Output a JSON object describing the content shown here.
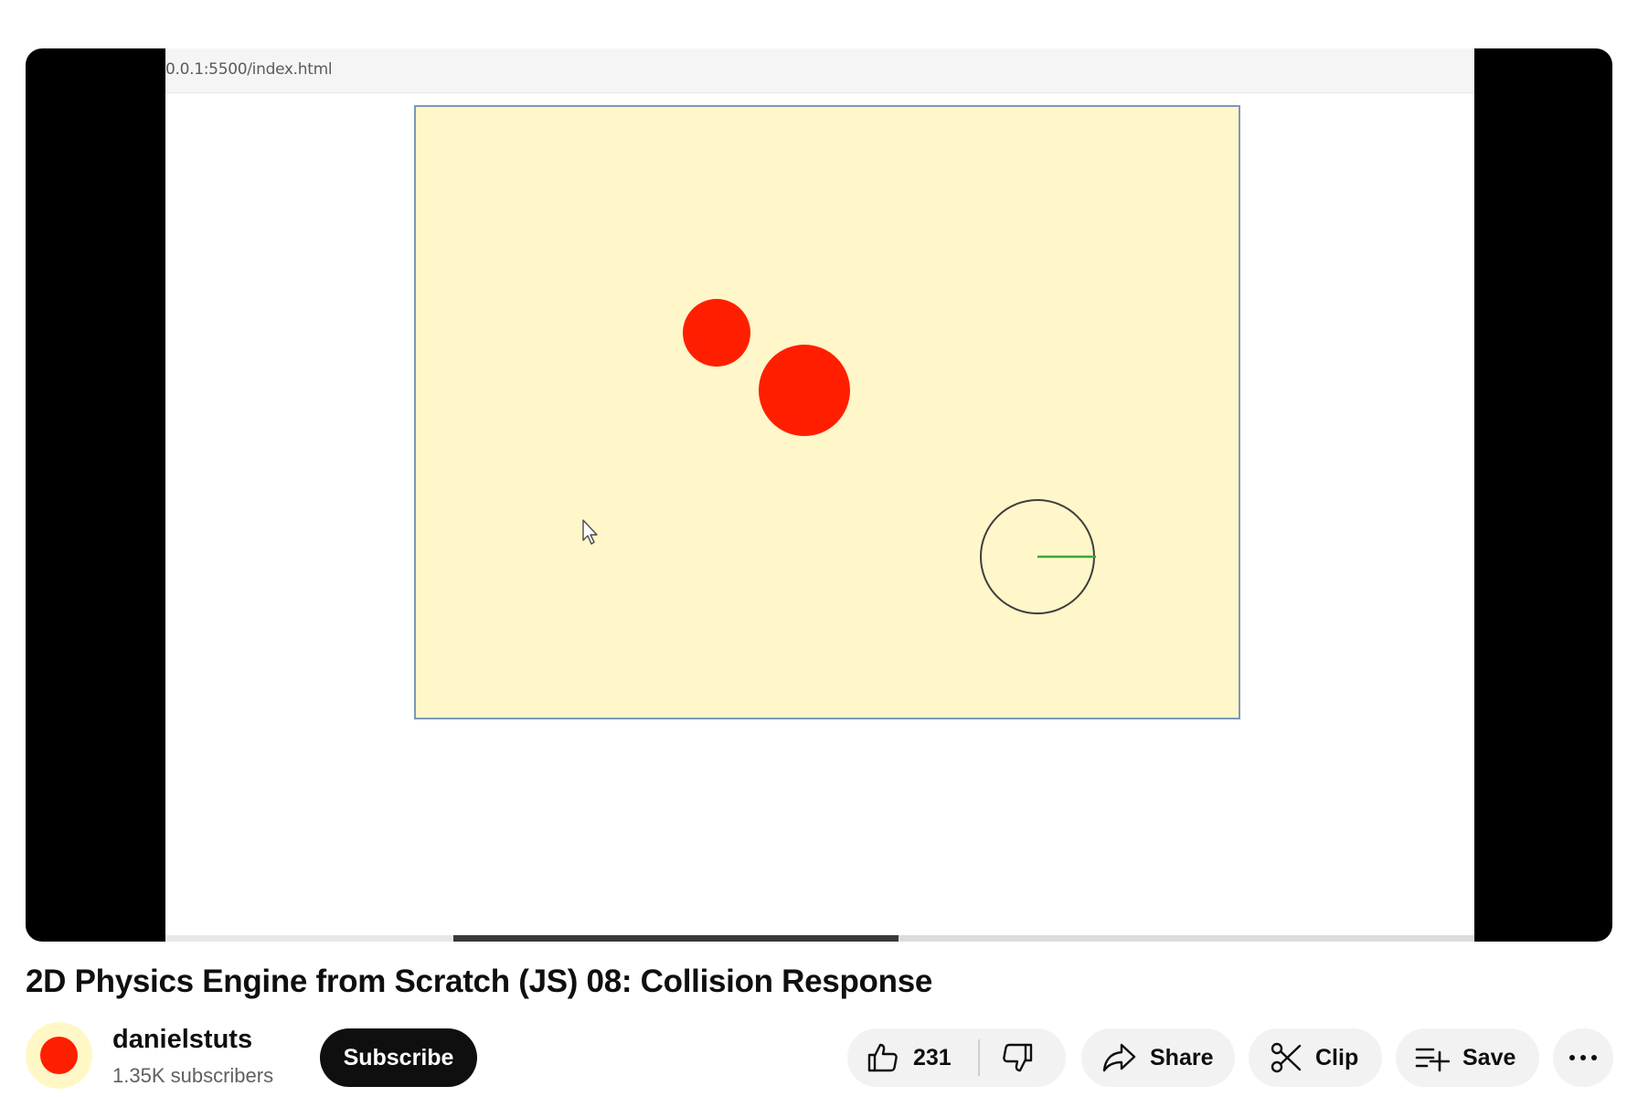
{
  "video": {
    "url": "0.0.1:5500/index.html",
    "title": "2D Physics Engine from Scratch (JS) 08: Collision Response",
    "canvas": {
      "background": "#fff6c9",
      "ball_color": "#ff1f00"
    },
    "progress": {
      "played_fraction": 0.22,
      "loaded_fraction": 0.56
    }
  },
  "channel": {
    "name": "danielstuts",
    "subscribers": "1.35K subscribers",
    "avatar_color": "#ff1f00"
  },
  "actions": {
    "subscribe_label": "Subscribe",
    "like_count": "231",
    "share_label": "Share",
    "clip_label": "Clip",
    "save_label": "Save"
  },
  "icons": {
    "like": "thumbs-up-icon",
    "dislike": "thumbs-down-icon",
    "share": "share-arrow-icon",
    "clip": "scissors-icon",
    "save": "playlist-add-icon",
    "more": "more-horizontal-icon"
  }
}
